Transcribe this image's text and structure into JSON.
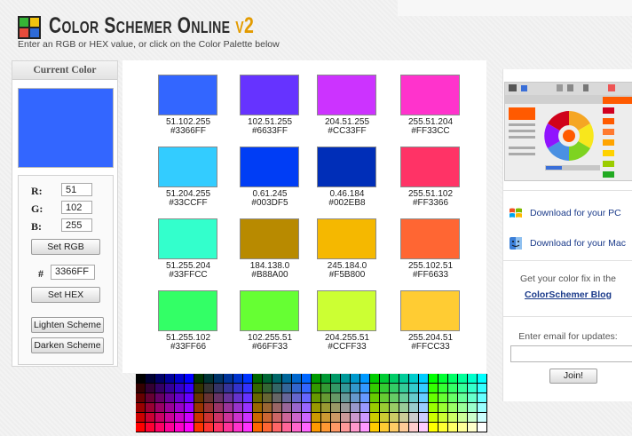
{
  "header": {
    "title_main": "Color Schemer Online",
    "title_version": "v2",
    "subtitle": "Enter an RGB or HEX value, or click on the Color Palette below"
  },
  "current_color": {
    "label": "Current Color",
    "hex_color": "#3366FF",
    "r_label": "R:",
    "g_label": "G:",
    "b_label": "B:",
    "r": "51",
    "g": "102",
    "b": "255",
    "set_rgb_label": "Set RGB",
    "hash": "#",
    "hex": "3366FF",
    "set_hex_label": "Set HEX",
    "lighten_label": "Lighten Scheme",
    "darken_label": "Darken Scheme"
  },
  "scheme": [
    {
      "rgb": "51.102.255",
      "hex": "#3366FF",
      "color": "#3366FF"
    },
    {
      "rgb": "102.51.255",
      "hex": "#6633FF",
      "color": "#6633FF"
    },
    {
      "rgb": "204.51.255",
      "hex": "#CC33FF",
      "color": "#CC33FF"
    },
    {
      "rgb": "255.51.204",
      "hex": "#FF33CC",
      "color": "#FF33CC"
    },
    {
      "rgb": "51.204.255",
      "hex": "#33CCFF",
      "color": "#33CCFF"
    },
    {
      "rgb": "0.61.245",
      "hex": "#003DF5",
      "color": "#003DF5"
    },
    {
      "rgb": "0.46.184",
      "hex": "#002EB8",
      "color": "#002EB8"
    },
    {
      "rgb": "255.51.102",
      "hex": "#FF3366",
      "color": "#FF3366"
    },
    {
      "rgb": "51.255.204",
      "hex": "#33FFCC",
      "color": "#33FFCC"
    },
    {
      "rgb": "184.138.0",
      "hex": "#B88A00",
      "color": "#B88A00"
    },
    {
      "rgb": "245.184.0",
      "hex": "#F5B800",
      "color": "#F5B800"
    },
    {
      "rgb": "255.102.51",
      "hex": "#FF6633",
      "color": "#FF6633"
    },
    {
      "rgb": "51.255.102",
      "hex": "#33FF66",
      "color": "#33FF66"
    },
    {
      "rgb": "102.255.51",
      "hex": "#66FF33",
      "color": "#66FF33"
    },
    {
      "rgb": "204.255.51",
      "hex": "#CCFF33",
      "color": "#CCFF33"
    },
    {
      "rgb": "255.204.51",
      "hex": "#FFCC33",
      "color": "#FFCC33"
    }
  ],
  "palette": {
    "levels": [
      "00",
      "33",
      "66",
      "99",
      "CC",
      "FF"
    ]
  },
  "sidebar": {
    "download_pc": "Download for your PC",
    "download_mac": "Download for your Mac",
    "fix_text": "Get your color fix in the",
    "blog_link": "ColorSchemer Blog",
    "email_label": "Enter email for updates:",
    "email_value": "",
    "join_label": "Join!"
  },
  "colors": {
    "accent": "#e39b00",
    "link": "#1a3a8a"
  }
}
